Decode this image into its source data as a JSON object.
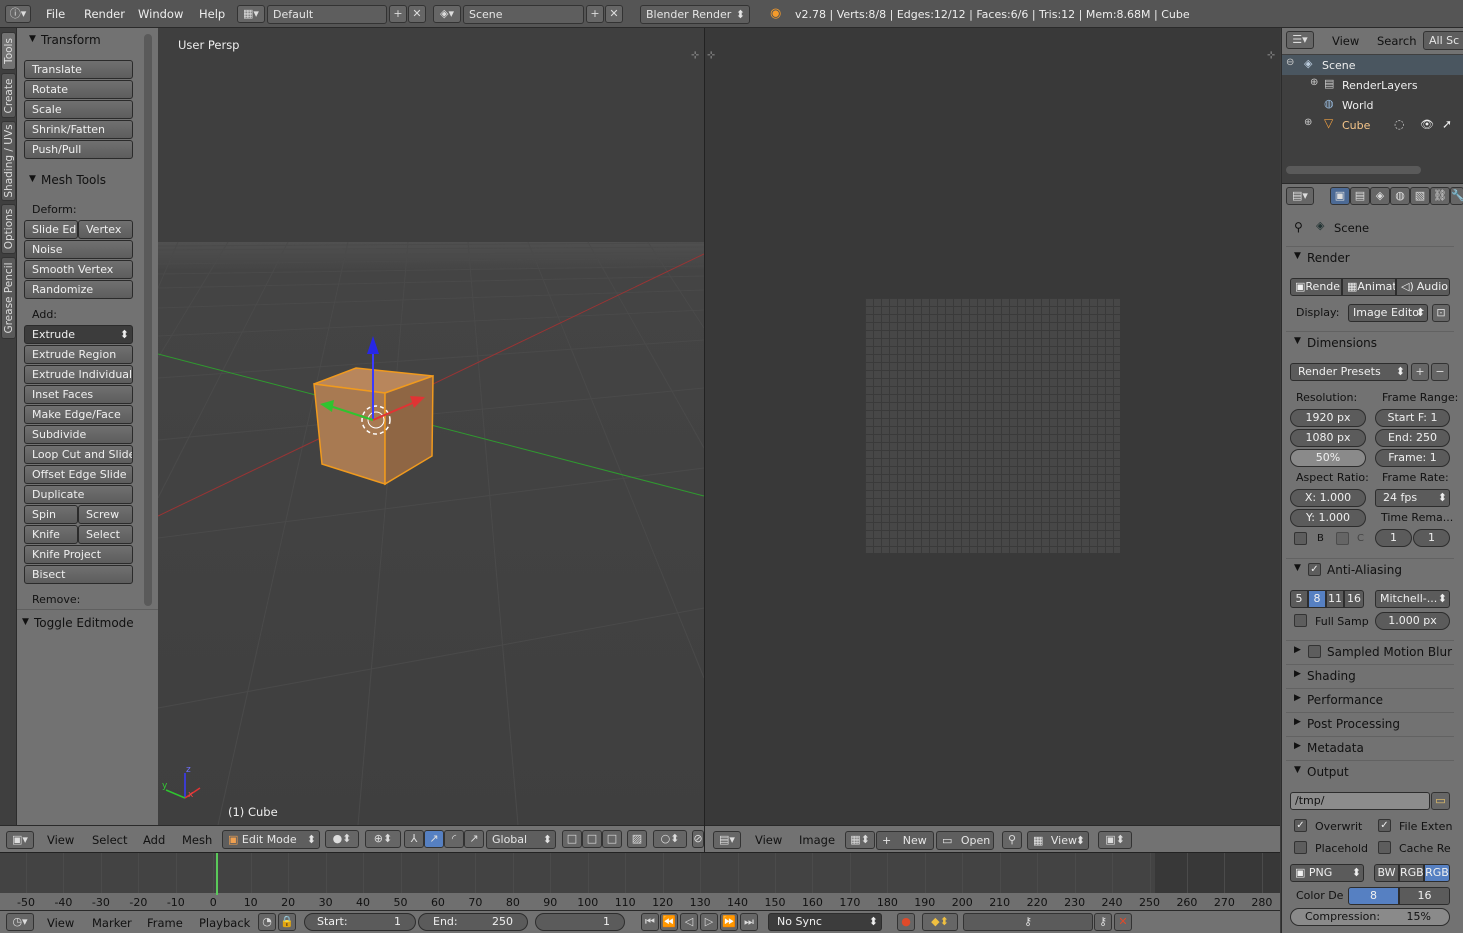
{
  "topbar": {
    "menus": [
      "File",
      "Render",
      "Window",
      "Help"
    ],
    "layout": "Default",
    "scene": "Scene",
    "engine": "Blender Render",
    "stats": "v2.78 | Verts:8/8 | Edges:12/12 | Faces:6/6 | Tris:12 | Mem:8.68M | Cube"
  },
  "tabs": [
    "Tools",
    "Create",
    "Shading / UVs",
    "Options",
    "Grease Pencil"
  ],
  "toolshelf": {
    "transform_title": "Transform",
    "transform": [
      "Translate",
      "Rotate",
      "Scale",
      "Shrink/Fatten",
      "Push/Pull"
    ],
    "mesh_title": "Mesh Tools",
    "deform_label": "Deform:",
    "slide_edge": "Slide Ed",
    "vertex": "Vertex",
    "noise": "Noise",
    "smooth": "Smooth Vertex",
    "randomize": "Randomize",
    "add_label": "Add:",
    "extrude": "Extrude",
    "add_items": [
      "Extrude Region",
      "Extrude Individual",
      "Inset Faces",
      "Make Edge/Face",
      "Subdivide",
      "Loop Cut and Slide",
      "Offset Edge Slide",
      "Duplicate"
    ],
    "spin": "Spin",
    "screw": "Screw",
    "knife": "Knife",
    "select": "Select",
    "knife_project": "Knife Project",
    "bisect": "Bisect",
    "remove_label": "Remove:",
    "toggle_editmode": "Toggle Editmode"
  },
  "view3d": {
    "title": "User Persp",
    "object": "(1) Cube",
    "axis_z": "z",
    "axis_y": "y",
    "axis_x": "x"
  },
  "view3d_header": {
    "menus": [
      "View",
      "Select",
      "Add",
      "Mesh"
    ],
    "mode": "Edit Mode",
    "orientation": "Global"
  },
  "image_header": {
    "menus": [
      "View",
      "Image"
    ],
    "new": "New",
    "open": "Open",
    "view": "View"
  },
  "outliner": {
    "menus": [
      "View",
      "Search"
    ],
    "display": "All Sc",
    "items": [
      "Scene",
      "RenderLayers",
      "World",
      "Cube"
    ]
  },
  "properties": {
    "context": "Scene",
    "render_title": "Render",
    "render_btn": "Render",
    "animation_btn": "Animat",
    "audio_btn": "Audio",
    "display_label": "Display:",
    "display_value": "Image Editor",
    "dimensions_title": "Dimensions",
    "render_presets": "Render Presets",
    "resolution_label": "Resolution:",
    "frame_range_label": "Frame Range:",
    "res_x": "1920 px",
    "res_y": "1080 px",
    "res_pct": "50%",
    "start": "Start F: 1",
    "end": "End: 250",
    "frame_step": "Frame: 1",
    "aspect_label": "Aspect Ratio:",
    "frame_rate_label": "Frame Rate:",
    "aspect_x": "X: 1.000",
    "aspect_y": "Y: 1.000",
    "fps": "24 fps",
    "time_remap": "Time Rema...",
    "border_b": "B",
    "border_c": "C",
    "remap_old": "1",
    "remap_new": "1",
    "aa_title": "Anti-Aliasing",
    "aa_samples": [
      "5",
      "8",
      "11",
      "16"
    ],
    "aa_filter": "Mitchell-...",
    "full_sample": "Full Samp",
    "filter_size": "1.000 px",
    "collapsed": [
      "Sampled Motion Blur",
      "Shading",
      "Performance",
      "Post Processing",
      "Metadata"
    ],
    "output_title": "Output",
    "output_path": "/tmp/",
    "overwrite": "Overwrit",
    "file_ext": "File Exten",
    "placeholders": "Placehold",
    "cache": "Cache Re",
    "format": "PNG",
    "bw": "BW",
    "rgb": "RGB",
    "rgba": "RGB",
    "color_depth_label": "Color De",
    "depth_8": "8",
    "depth_16": "16",
    "compression": "Compression:",
    "compression_val": "15%"
  },
  "timeline": {
    "ticks": [
      "-50",
      "-40",
      "-30",
      "-20",
      "-10",
      "0",
      "10",
      "20",
      "30",
      "40",
      "50",
      "60",
      "70",
      "80",
      "90",
      "100",
      "110",
      "120",
      "130",
      "140",
      "150",
      "160",
      "170",
      "180",
      "190",
      "200",
      "210",
      "220",
      "230",
      "240",
      "250",
      "260",
      "270",
      "280"
    ]
  },
  "timeline_header": {
    "menus": [
      "View",
      "Marker",
      "Frame",
      "Playback"
    ],
    "start": "Start:",
    "start_val": "1",
    "end": "End:",
    "end_val": "250",
    "current": "1",
    "sync": "No Sync"
  }
}
